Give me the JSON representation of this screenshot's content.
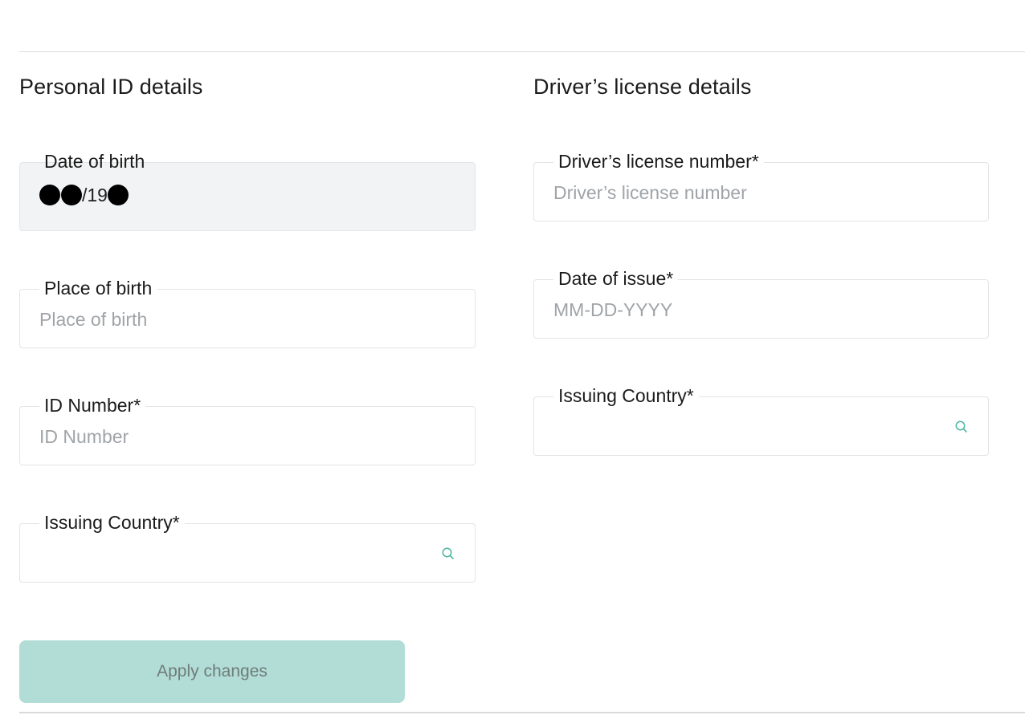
{
  "personal_id": {
    "title": "Personal ID details",
    "date_of_birth": {
      "label": "Date of birth",
      "value_visible_part": "/19",
      "redacted": true
    },
    "place_of_birth": {
      "label": "Place of birth",
      "placeholder": "Place of birth"
    },
    "id_number": {
      "label": "ID Number*",
      "placeholder": "ID Number"
    },
    "issuing_country": {
      "label": "Issuing Country*",
      "icon": "search-icon"
    }
  },
  "drivers_license": {
    "title": "Driver’s license details",
    "license_number": {
      "label": "Driver’s license number*",
      "placeholder": "Driver’s license number"
    },
    "date_of_issue": {
      "label": "Date of issue*",
      "placeholder": "MM-DD-YYYY"
    },
    "issuing_country": {
      "label": "Issuing Country*",
      "icon": "search-icon"
    }
  },
  "actions": {
    "apply_label": "Apply changes"
  },
  "colors": {
    "accent": "#4db6a3",
    "button_disabled_bg": "#b2ddd6",
    "readonly_bg": "#f2f3f4"
  }
}
